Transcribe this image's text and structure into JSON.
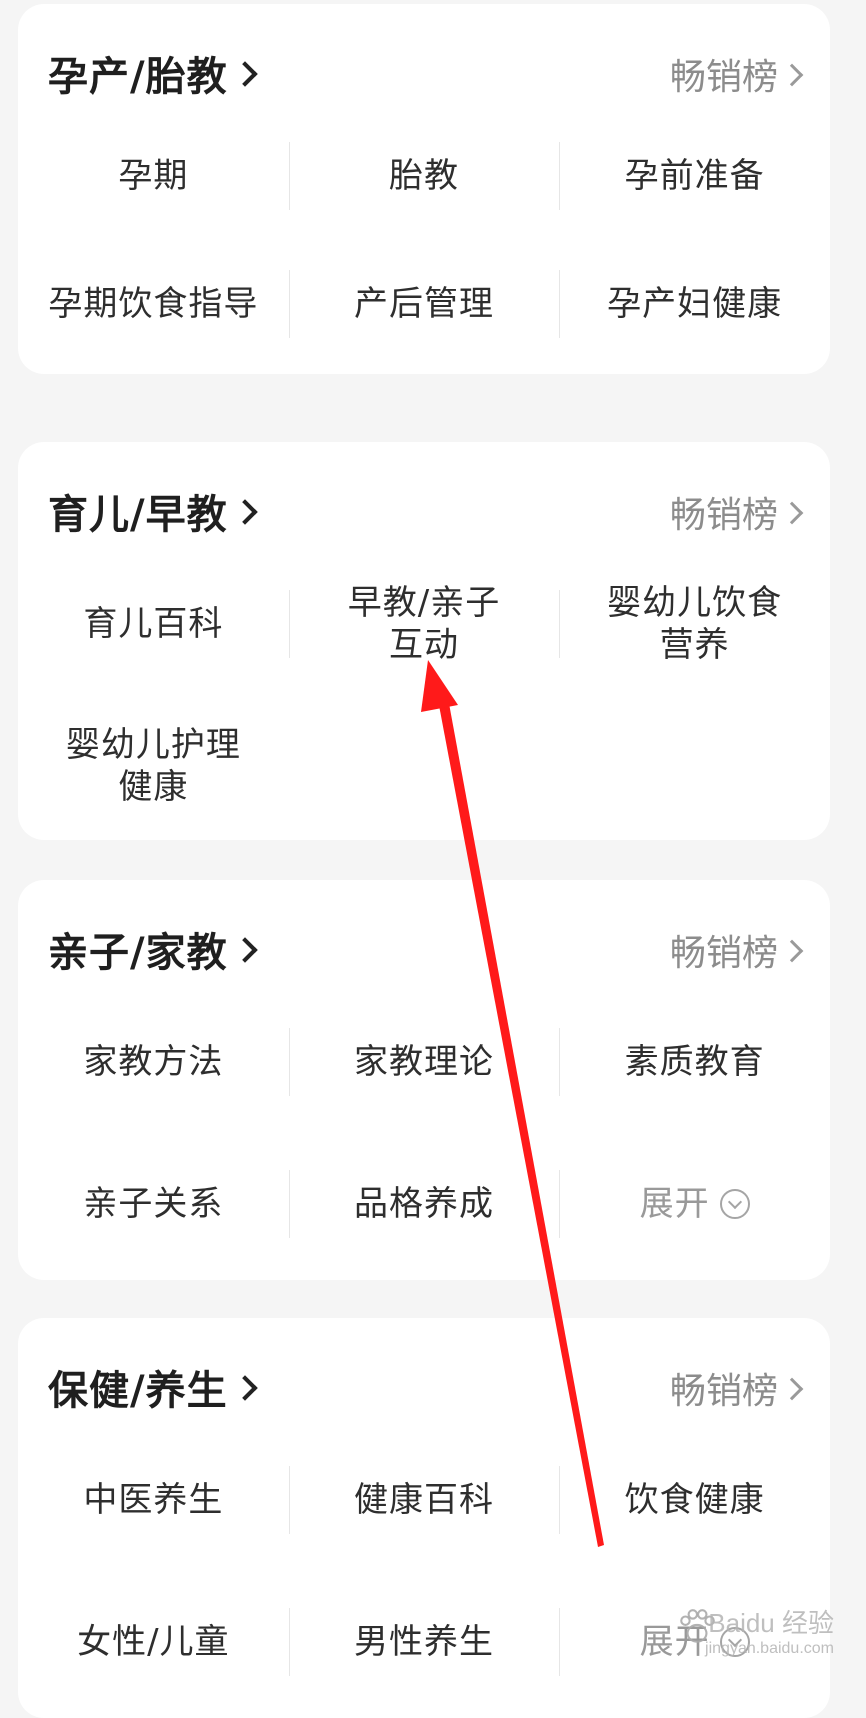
{
  "sections": [
    {
      "title": "孕产/胎教",
      "bestseller": "畅销榜",
      "rows": [
        [
          "孕期",
          "胎教",
          "孕前准备"
        ],
        [
          "孕期饮食指导",
          "产后管理",
          "孕产妇健康"
        ]
      ]
    },
    {
      "title": "育儿/早教",
      "bestseller": "畅销榜",
      "rows": [
        [
          "育儿百科",
          "早教/亲子\n互动",
          "婴幼儿饮食\n营养"
        ],
        [
          "婴幼儿护理\n健康",
          "",
          ""
        ]
      ]
    },
    {
      "title": "亲子/家教",
      "bestseller": "畅销榜",
      "rows": [
        [
          "家教方法",
          "家教理论",
          "素质教育"
        ],
        [
          "亲子关系",
          "品格养成",
          "展开"
        ]
      ]
    },
    {
      "title": "保健/养生",
      "bestseller": "畅销榜",
      "rows": [
        [
          "中医养生",
          "健康百科",
          "饮食健康"
        ],
        [
          "女性/儿童",
          "男性养生",
          "展开"
        ]
      ]
    }
  ],
  "watermark": {
    "text": "Baidu 经验",
    "sub": "jingyan.baidu.com"
  },
  "colors": {
    "annotation_arrow": "#ff1a1a",
    "title": "#1f1f1f",
    "muted": "#8c8c8c"
  }
}
